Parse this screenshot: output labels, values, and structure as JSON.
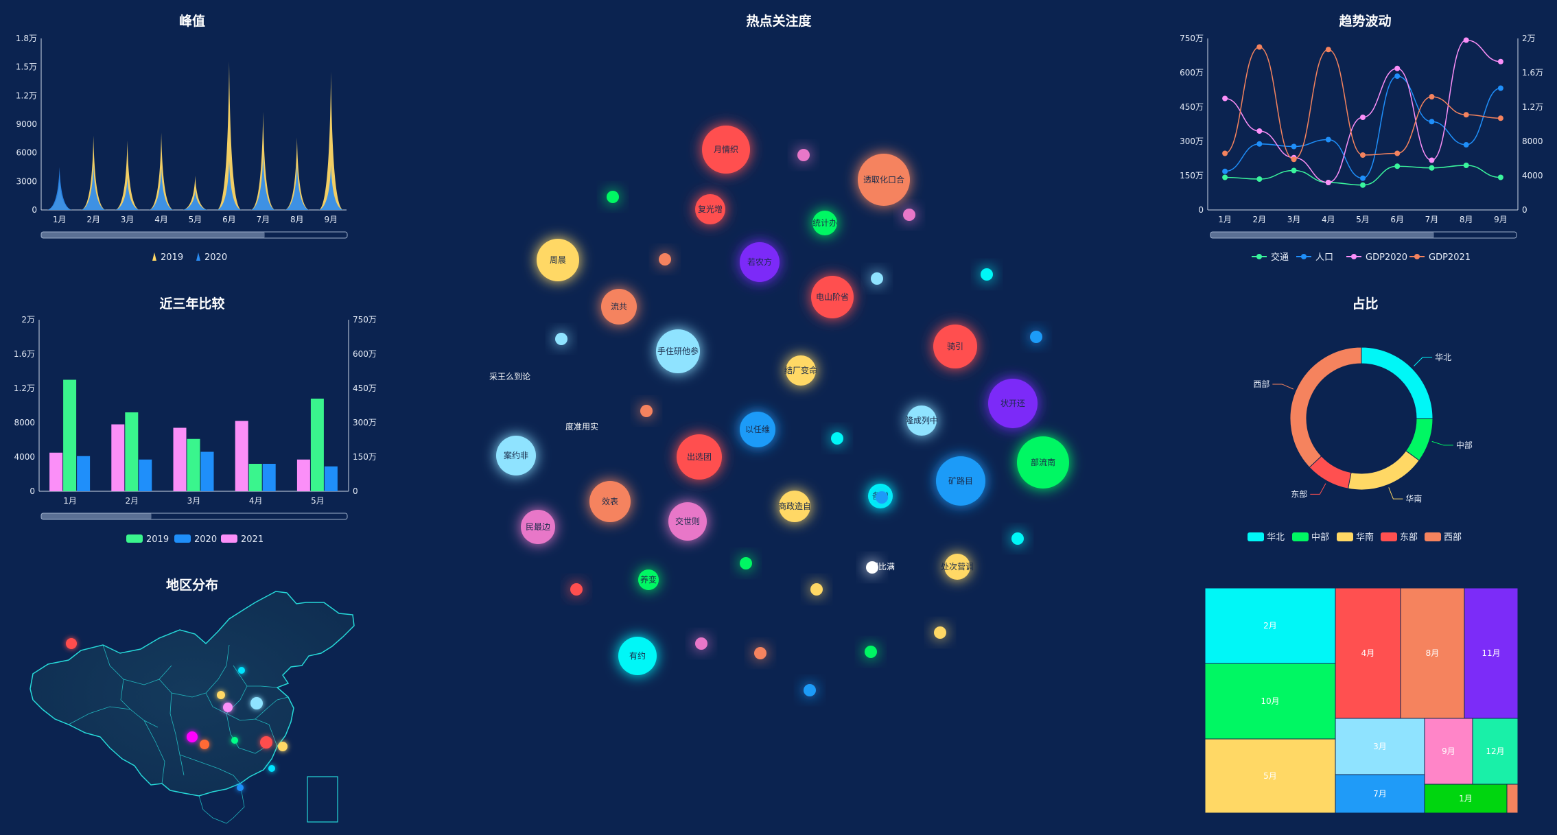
{
  "titles": {
    "peak": "峰值",
    "compare": "近三年比较",
    "region": "地区分布",
    "hot": "热点关注度",
    "trend": "趋势波动",
    "ratio": "占比"
  },
  "colors": {
    "bg": "#0b2350",
    "c2019": "#3af58d",
    "c2020": "#1f8ffa",
    "c2021": "#fb8ff8",
    "peakYellow": "#ffd865",
    "peakBlue": "#2a8bf2"
  },
  "chart_data": [
    {
      "id": "peak",
      "type": "area",
      "title": "峰值",
      "categories": [
        "1月",
        "2月",
        "3月",
        "4月",
        "5月",
        "6月",
        "7月",
        "8月",
        "9月"
      ],
      "y_ticks": [
        "0",
        "3000",
        "6000",
        "9000",
        "1.2万",
        "1.5万",
        "1.8万"
      ],
      "ylim": [
        0,
        18000
      ],
      "series": [
        {
          "name": "2019",
          "values": [
            3200,
            7800,
            7300,
            8100,
            3600,
            15600,
            10300,
            7600,
            14500
          ]
        },
        {
          "name": "2020",
          "values": [
            4500,
            4700,
            3400,
            4400,
            2000,
            5200,
            5800,
            4800,
            4700
          ]
        }
      ],
      "legend": "bottom",
      "dataZoom": true
    },
    {
      "id": "compare",
      "type": "bar",
      "title": "近三年比较",
      "categories": [
        "1月",
        "2月",
        "3月",
        "4月",
        "5月"
      ],
      "y_ticks_left": [
        "0",
        "4000",
        "8000",
        "1.2万",
        "1.6万",
        "2万"
      ],
      "y_ticks_right": [
        "0",
        "150万",
        "300万",
        "450万",
        "600万",
        "750万"
      ],
      "ylim": [
        0,
        20000
      ],
      "series": [
        {
          "name": "2019",
          "values": [
            13000,
            9200,
            6100,
            3200,
            10800
          ]
        },
        {
          "name": "2020",
          "values": [
            4100,
            3700,
            4600,
            3200,
            2900
          ]
        },
        {
          "name": "2021",
          "values": [
            4500,
            7800,
            7400,
            8200,
            3700
          ]
        }
      ],
      "series_order": [
        "2021",
        "2019",
        "2020"
      ],
      "legend": "bottom",
      "dataZoom": true
    },
    {
      "id": "trend",
      "type": "line",
      "title": "趋势波动",
      "categories": [
        "1月",
        "2月",
        "3月",
        "4月",
        "5月",
        "6月",
        "7月",
        "8月",
        "9月"
      ],
      "y_ticks_left": [
        "0",
        "150万",
        "300万",
        "450万",
        "600万",
        "750万"
      ],
      "y_ticks_right": [
        "0",
        "4000",
        "8000",
        "1.2万",
        "1.6万",
        "2万"
      ],
      "ylim": [
        0,
        20000
      ],
      "series": [
        {
          "name": "交通",
          "values": [
            3800,
            3600,
            4600,
            3200,
            2900,
            5100,
            4900,
            5200,
            3800
          ]
        },
        {
          "name": "人口",
          "values": [
            4500,
            7700,
            7400,
            8200,
            3700,
            15600,
            10300,
            7600,
            14200
          ]
        },
        {
          "name": "GDP2020",
          "values": [
            13000,
            9200,
            6100,
            3200,
            10800,
            16500,
            5800,
            19800,
            17300
          ]
        },
        {
          "name": "GDP2021",
          "values": [
            6600,
            19000,
            5900,
            18700,
            6400,
            6600,
            13200,
            11100,
            10700
          ]
        }
      ],
      "legend": "bottom",
      "dataZoom": true
    },
    {
      "id": "ratio",
      "type": "pie",
      "title": "占比",
      "series": [
        {
          "name": "华北",
          "value": 25
        },
        {
          "name": "中部",
          "value": 10
        },
        {
          "name": "华南",
          "value": 18
        },
        {
          "name": "东部",
          "value": 10
        },
        {
          "name": "西部",
          "value": 37
        }
      ],
      "legend": "bottom"
    },
    {
      "id": "treemap",
      "type": "treemap",
      "items": [
        {
          "name": "2月",
          "value": 14
        },
        {
          "name": "10月",
          "value": 14
        },
        {
          "name": "5月",
          "value": 14
        },
        {
          "name": "4月",
          "value": 9
        },
        {
          "name": "8月",
          "value": 9
        },
        {
          "name": "11月",
          "value": 7
        },
        {
          "name": "3月",
          "value": 5
        },
        {
          "name": "7月",
          "value": 4
        },
        {
          "name": "9月",
          "value": 3
        },
        {
          "name": "12月",
          "value": 3
        },
        {
          "name": "1月",
          "value": 3
        }
      ]
    },
    {
      "id": "hot",
      "type": "scatter",
      "title": "热点关注度",
      "bubbles": [
        {
          "label": "月情织",
          "size": 70
        },
        {
          "label": "透取化口合",
          "size": 76
        },
        {
          "label": "复光增",
          "size": 44
        },
        {
          "label": "若农方",
          "size": 58
        },
        {
          "label": "周晨",
          "size": 62
        },
        {
          "label": "电山阶省",
          "size": 62
        },
        {
          "label": "流共",
          "size": 52
        },
        {
          "label": "手住研他参",
          "size": 64
        },
        {
          "label": "骑引",
          "size": 64
        },
        {
          "label": "状开还",
          "size": 72
        },
        {
          "label": "以任维",
          "size": 52
        },
        {
          "label": "隆成列中",
          "size": 44
        },
        {
          "label": "出选团",
          "size": 66
        },
        {
          "label": "案约非",
          "size": 58
        },
        {
          "label": "部流南",
          "size": 76
        },
        {
          "label": "矿路目",
          "size": 72
        },
        {
          "label": "效表",
          "size": 60
        },
        {
          "label": "交世则",
          "size": 56
        },
        {
          "label": "商政造自",
          "size": 46
        },
        {
          "label": "民最边",
          "size": 50
        },
        {
          "label": "有约",
          "size": 56
        },
        {
          "label": "处次营调",
          "size": 38
        },
        {
          "label": "备增",
          "size": 36
        },
        {
          "label": "统计办",
          "size": 36
        },
        {
          "label": "结厂变命",
          "size": 44
        },
        {
          "label": "养变",
          "size": 30
        },
        {
          "label": "门比满",
          "size": 0
        },
        {
          "label": "采王么到论",
          "size": 0
        },
        {
          "label": "度准用实",
          "size": 0
        }
      ]
    }
  ],
  "map_points": [
    {
      "color": "#ff4d4d"
    },
    {
      "color": "#ffd865"
    },
    {
      "color": "#fb8ff8"
    },
    {
      "color": "#8fe3ff"
    },
    {
      "color": "#ff00ff"
    },
    {
      "color": "#ff6b35"
    },
    {
      "color": "#00ff88"
    },
    {
      "color": "#ff4d4d"
    },
    {
      "color": "#ffd865"
    },
    {
      "color": "#00e5ff"
    },
    {
      "color": "#1f8ffa"
    },
    {
      "color": "#00e5ff"
    }
  ]
}
